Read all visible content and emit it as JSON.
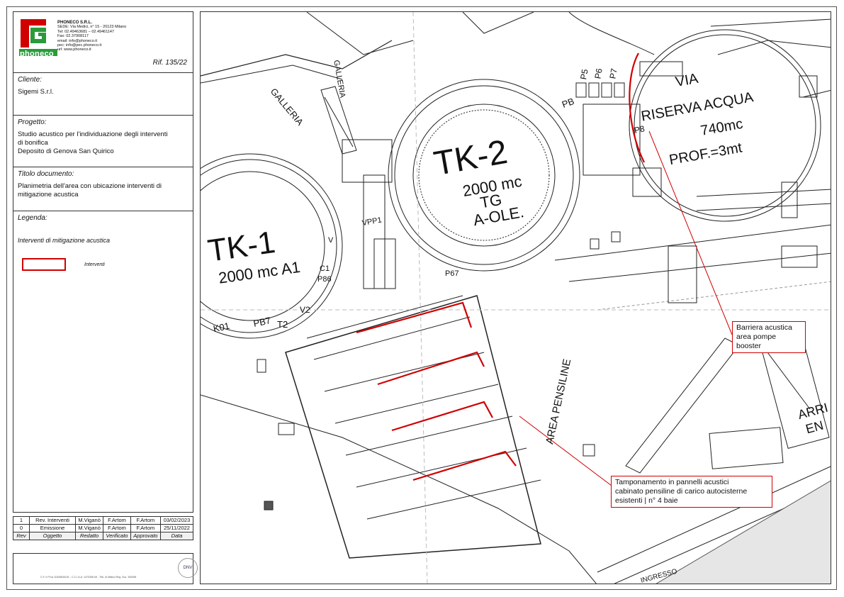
{
  "header": {
    "company": "PHONECO S.R.L.",
    "address_lines": [
      "SEDE: Via Medici, n° 15 - 20123 Milano",
      "Tel: 02.49463681 – 02.49461147",
      "Fax: 02.37908117",
      "email: info@phoneco.it",
      "pec: info@pec.phoneco.it",
      "url: www.phoneco.it"
    ],
    "logo_text": "phoneco",
    "reference": "Rif. 135/22"
  },
  "client": {
    "label": "Cliente:",
    "value": "Sigemi S.r.l."
  },
  "project": {
    "label": "Progetto:",
    "lines": [
      "Studio acustico per l'individuazione degli interventi",
      "di bonifica",
      "Deposito di Genova San Quirico"
    ]
  },
  "document_title": {
    "label": "Titolo documento:",
    "lines": [
      "Planimetria dell'area con ubicazione interventi di",
      "mitigazione acustica"
    ]
  },
  "legend": {
    "label": "Legenda:",
    "subtitle": "Interventi di mitigazione acustica",
    "item_label": "Interventi",
    "item_color": "#d00000"
  },
  "revisions": {
    "rows": [
      [
        "1",
        "Rev. Interventi",
        "M.Viganò",
        "F.Artom",
        "F.Artom",
        "03/02/2023"
      ],
      [
        "0",
        "Emissione",
        "M.Viganò",
        "F.Artom",
        "F.Artom",
        "25/11/2022"
      ]
    ],
    "headers": [
      "Rev",
      "Oggetto",
      "Redatto",
      "Verificato",
      "Approvato",
      "Data"
    ]
  },
  "footer": {
    "legal": "C.F. e P.Iva 11626630151 - C.C.I.A.A. 1470356 MI - Trib. di Milano Reg. Soc. 354398",
    "cert": "DNV"
  },
  "map": {
    "tanks": [
      {
        "name": "TK-1",
        "capacity": "2000 mc A1"
      },
      {
        "name": "TK-2",
        "capacity": "2000 mc",
        "line2": "TG",
        "line3": "A-OLE."
      },
      {
        "name": "VIA",
        "line2": "RISERVA ACQUA",
        "capacity": "740mc",
        "line3": "PROF.=3mt"
      }
    ],
    "labels": {
      "galleria": "GALLERIA",
      "pensiline": "AREA PENSILINE",
      "ingresso": "INGRESSO",
      "arrivo": "ARRI",
      "arrivo2": "EN",
      "pb": "PB",
      "p5": "P5",
      "p6": "P6",
      "p7": "P7",
      "p8": "P8",
      "vpp1": "VPP1",
      "pb7": "PB7",
      "k01": "K01",
      "t2": "T2",
      "p86": "P86",
      "c1": "C1",
      "v": "V",
      "p67": "P67",
      "v2": "V2"
    },
    "callouts": [
      {
        "lines": [
          "Barriera acustica",
          "area pompe",
          "booster"
        ]
      },
      {
        "lines": [
          "Tamponamento in pannelli acustici",
          "cabinato pensiline di carico autocisterne",
          "esistenti | n° 4 baie"
        ]
      }
    ],
    "intervention_color": "#d00000"
  }
}
